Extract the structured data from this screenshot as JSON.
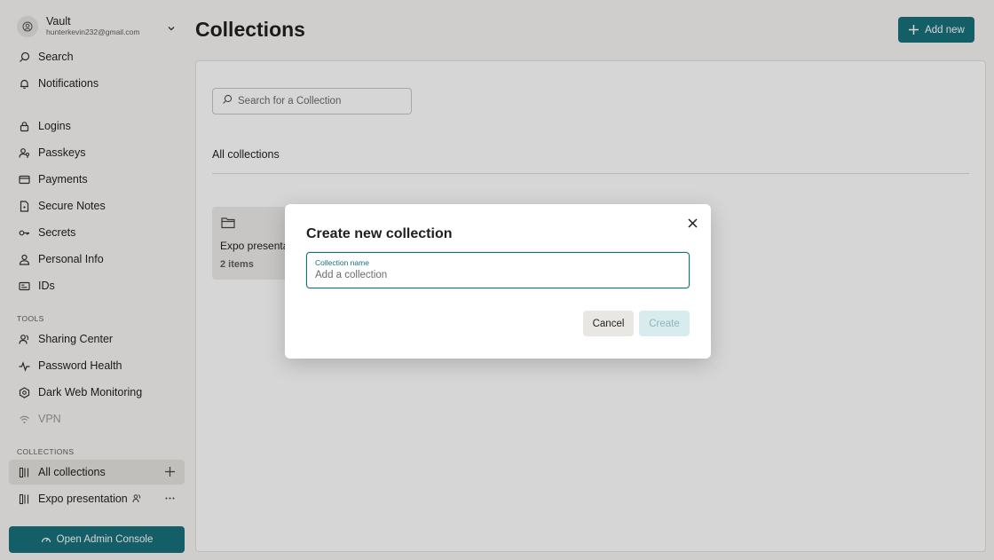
{
  "account": {
    "name": "Vault",
    "email": "hunterkevin232@gmail.com"
  },
  "nav": {
    "search": "Search",
    "notifications": "Notifications",
    "logins": "Logins",
    "passkeys": "Passkeys",
    "payments": "Payments",
    "secure_notes": "Secure Notes",
    "secrets": "Secrets",
    "personal_info": "Personal Info",
    "ids": "IDs"
  },
  "tools": {
    "label": "TOOLS",
    "sharing_center": "Sharing Center",
    "password_health": "Password Health",
    "dark_web_monitoring": "Dark Web Monitoring",
    "vpn": "VPN"
  },
  "collections_nav": {
    "label": "COLLECTIONS",
    "all": "All collections",
    "expo": "Expo presentation"
  },
  "admin_button": "Open Admin Console",
  "main": {
    "title": "Collections",
    "add_new": "Add new",
    "search_placeholder": "Search for a Collection",
    "all_heading": "All collections",
    "card": {
      "name": "Expo presentation",
      "count": "2 items"
    }
  },
  "modal": {
    "title": "Create new collection",
    "field_label": "Collection name",
    "field_placeholder": "Add a collection",
    "field_value": "",
    "cancel": "Cancel",
    "create": "Create"
  },
  "colors": {
    "accent": "#17707b",
    "sidebar_bg": "#f7f6f3",
    "panel_bg": "#ffffff"
  }
}
